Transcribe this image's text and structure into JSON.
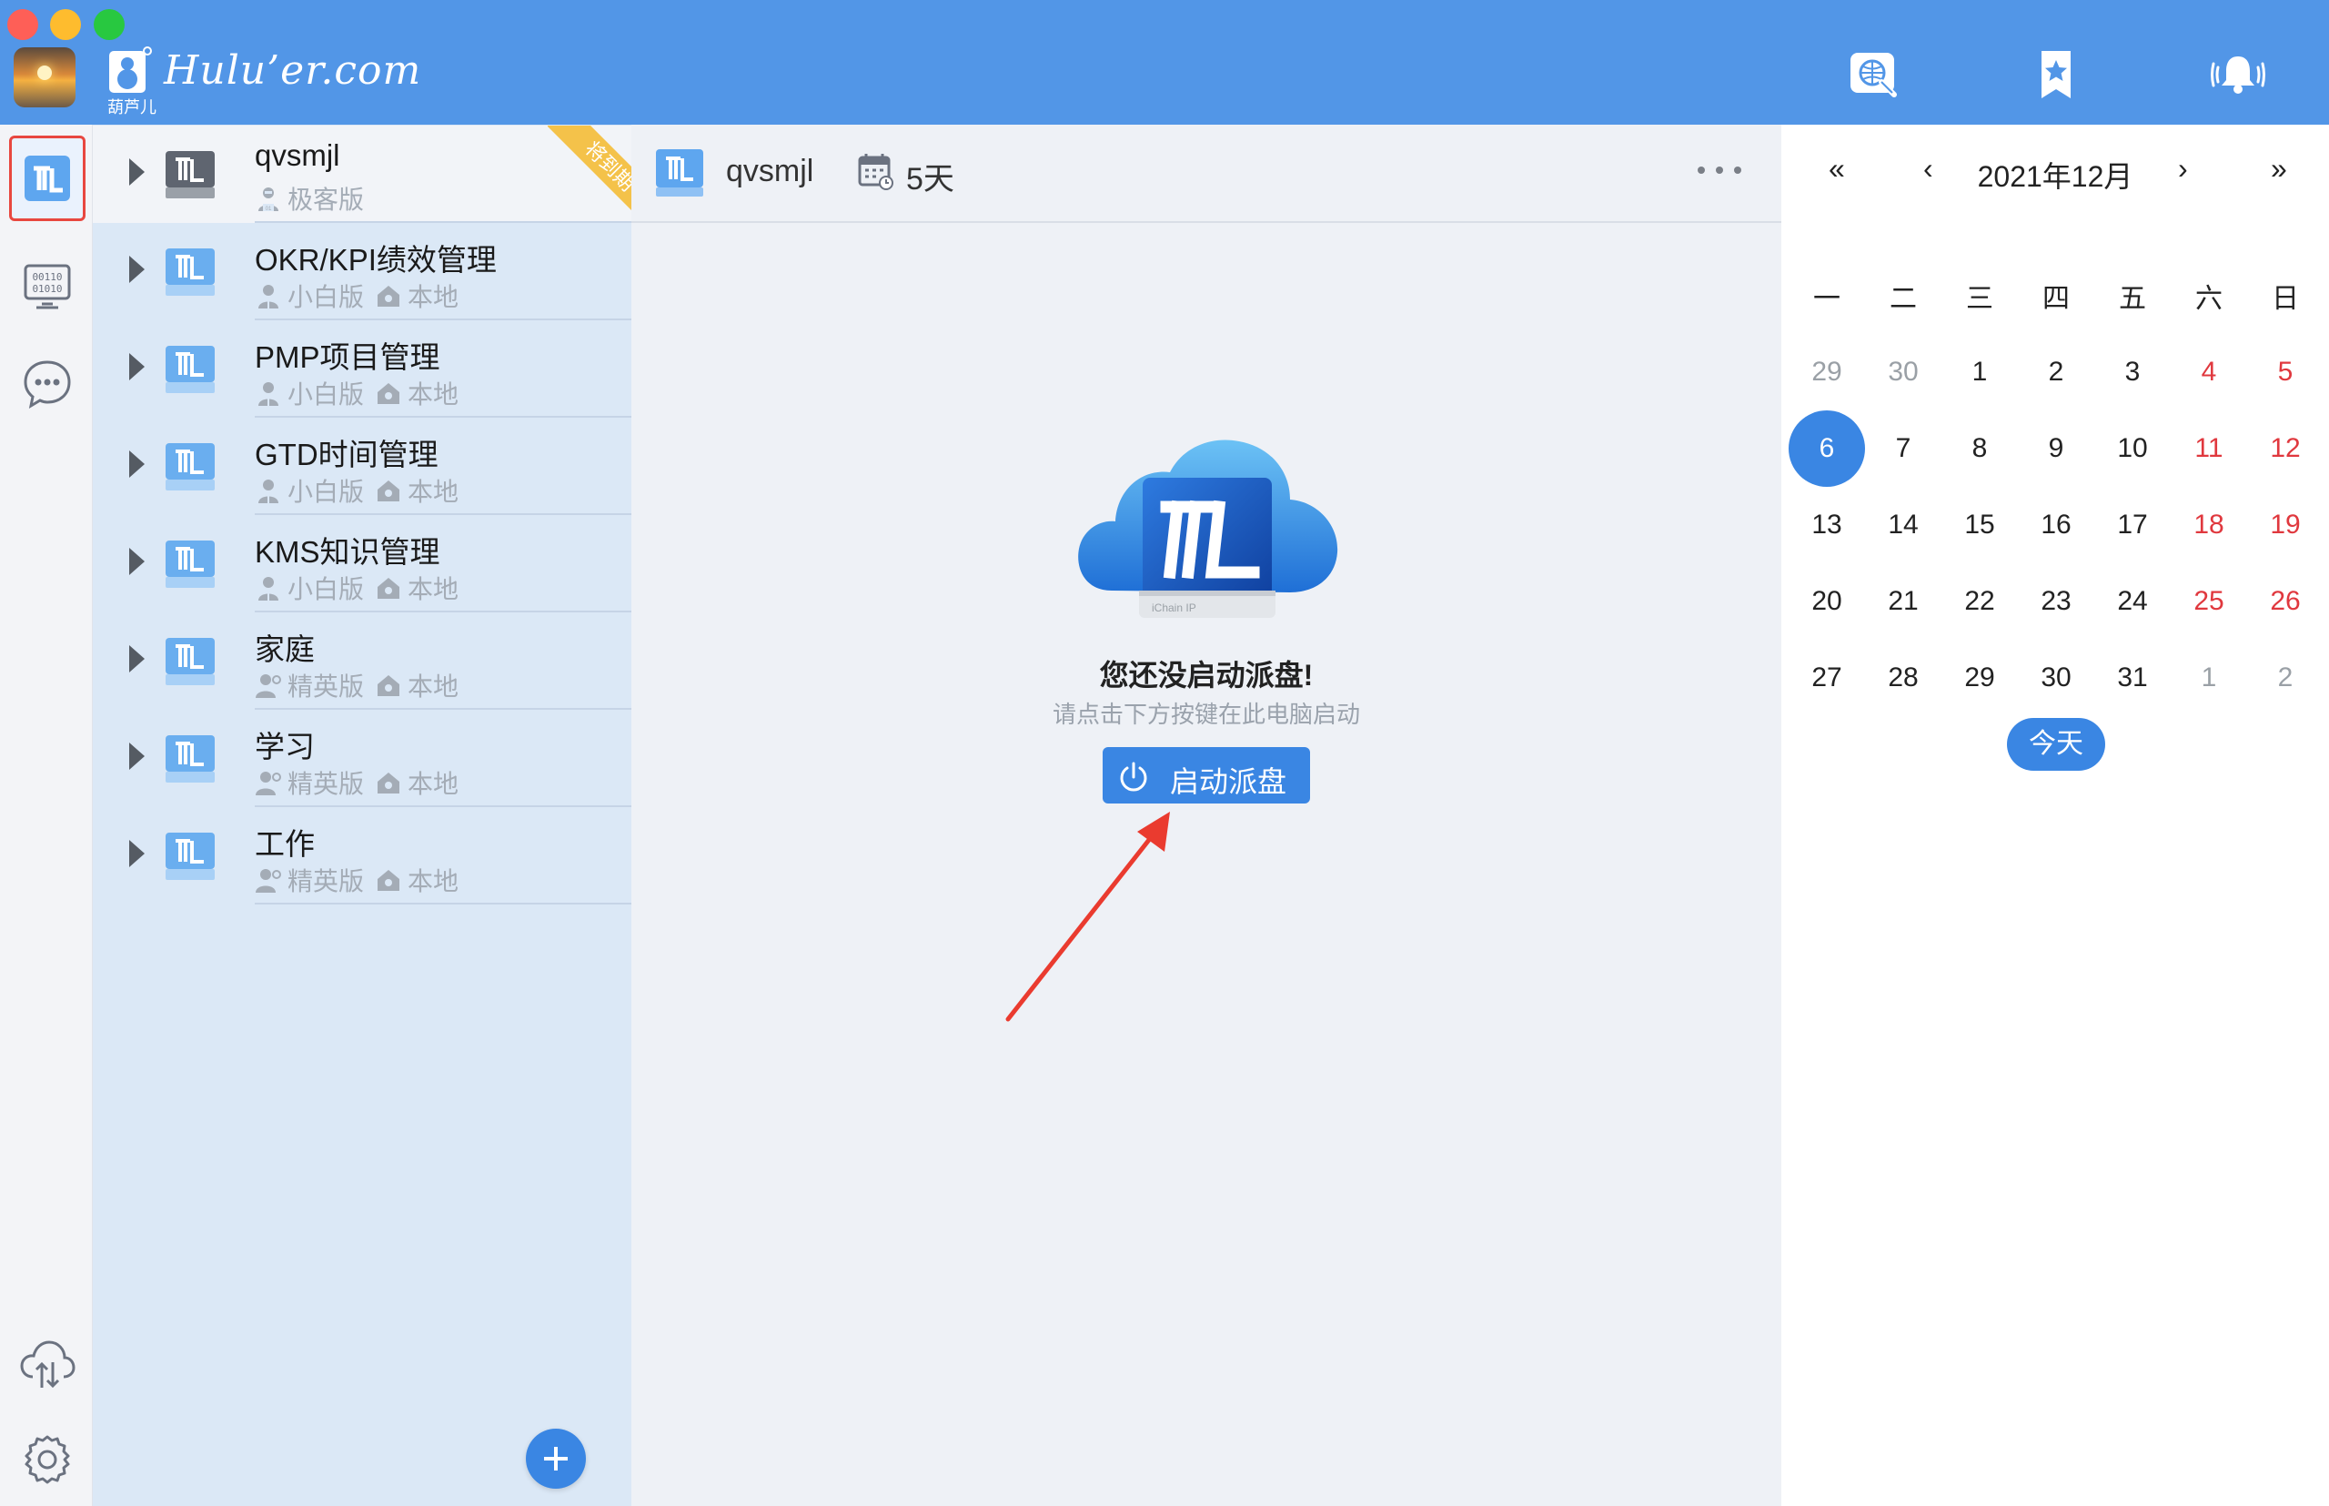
{
  "brand": {
    "logo_text": "Hulu’er.com",
    "logo_sub": "葫芦儿"
  },
  "toolbar": {
    "icons": [
      "globe-search-icon",
      "star-bookmark-icon",
      "bell-icon"
    ]
  },
  "rail": {
    "icons": [
      "paidisk-icon",
      "binary-data-icon",
      "chat-bubble-icon",
      "cloud-sync-icon",
      "gear-icon"
    ]
  },
  "disks": [
    {
      "name": "qvsmjl",
      "tier": "极客版",
      "location": "",
      "ribbon": "将到期",
      "active": true
    },
    {
      "name": "OKR/KPI绩效管理",
      "tier": "小白版",
      "location": "本地"
    },
    {
      "name": "PMP项目管理",
      "tier": "小白版",
      "location": "本地"
    },
    {
      "name": "GTD时间管理",
      "tier": "小白版",
      "location": "本地"
    },
    {
      "name": "KMS知识管理",
      "tier": "小白版",
      "location": "本地"
    },
    {
      "name": "家庭",
      "tier": "精英版",
      "location": "本地"
    },
    {
      "name": "学习",
      "tier": "精英版",
      "location": "本地"
    },
    {
      "name": "工作",
      "tier": "精英版",
      "location": "本地"
    }
  ],
  "main": {
    "disk_name": "qvsmjl",
    "days_left": "5天",
    "empty_title": "您还没启动派盘!",
    "empty_subtitle": "请点击下方按键在此电脑启动",
    "start_button": "启动派盘",
    "cloud_label": "iChain IP"
  },
  "calendar": {
    "prev_year": "«",
    "prev_month": "‹",
    "title": "2021年12月",
    "next_month": "›",
    "next_year": "»",
    "weekdays": [
      "一",
      "二",
      "三",
      "四",
      "五",
      "六",
      "日"
    ],
    "weeks": [
      [
        "29",
        "30",
        "1",
        "2",
        "3",
        "4",
        "5"
      ],
      [
        "6",
        "7",
        "8",
        "9",
        "10",
        "11",
        "12"
      ],
      [
        "13",
        "14",
        "15",
        "16",
        "17",
        "18",
        "19"
      ],
      [
        "20",
        "21",
        "22",
        "23",
        "24",
        "25",
        "26"
      ],
      [
        "27",
        "28",
        "29",
        "30",
        "31",
        "1",
        "2"
      ]
    ],
    "selected_day": "6",
    "today_button": "今天"
  },
  "colors": {
    "titlebar": "#5296e7",
    "accent": "#3a86e3",
    "weekend": "#e0383e",
    "ribbon": "#f4c24a"
  }
}
